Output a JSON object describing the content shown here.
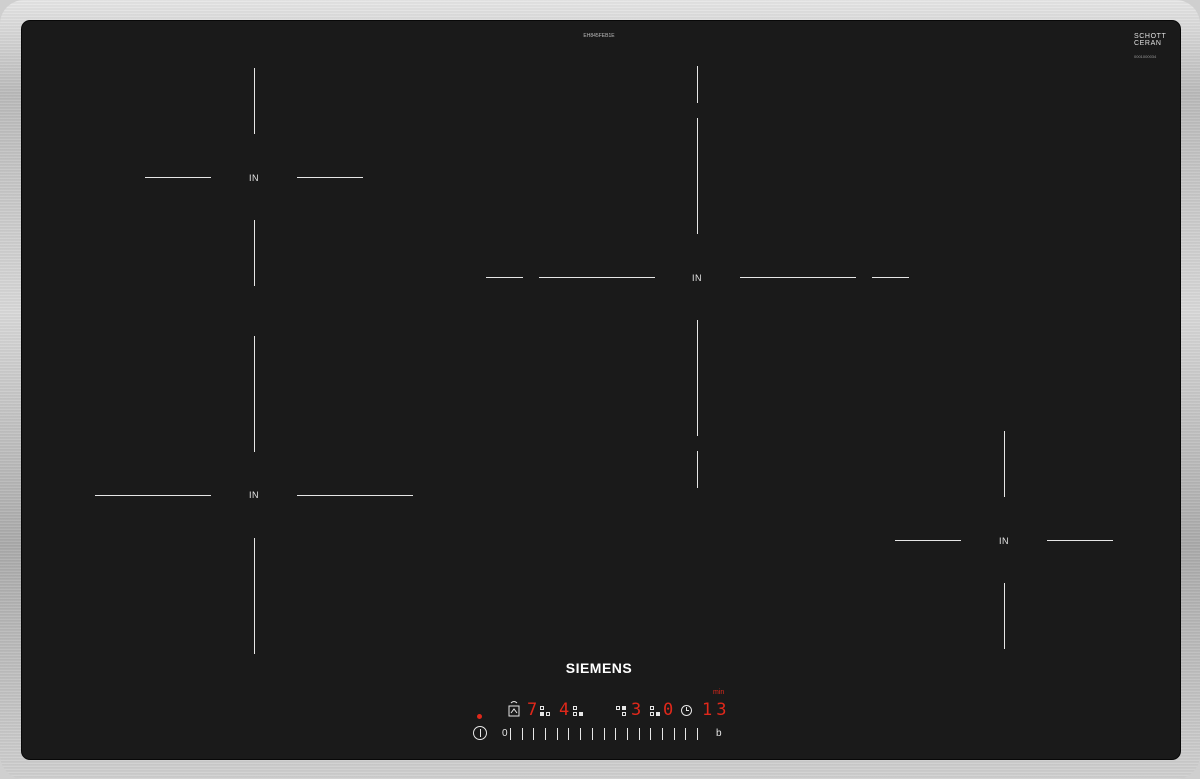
{
  "hob": {
    "model_code": "EH845FEB1E",
    "glass_brand_line1": "SCHOTT",
    "glass_brand_line2": "CERAN",
    "glass_code": "0001000034",
    "brand": "SIEMENS"
  },
  "zones": [
    {
      "label": "IN"
    },
    {
      "label": "IN"
    },
    {
      "label": "IN"
    },
    {
      "label": "IN"
    }
  ],
  "controls": {
    "zone_display_1": "7",
    "zone_display_2": "4",
    "zone_display_3": "3",
    "zone_display_4": "0",
    "timer_value": "13",
    "timer_unit": "min",
    "slider_min_label": "0",
    "slider_boost_label": "b",
    "slider_ticks": 17
  },
  "colors": {
    "glass": "#1a1a1a",
    "indicator_red": "#e0281a",
    "marking_white": "#e6e6e6"
  },
  "icons": [
    "power-icon",
    "clock-icon",
    "wipe-protection-icon"
  ]
}
